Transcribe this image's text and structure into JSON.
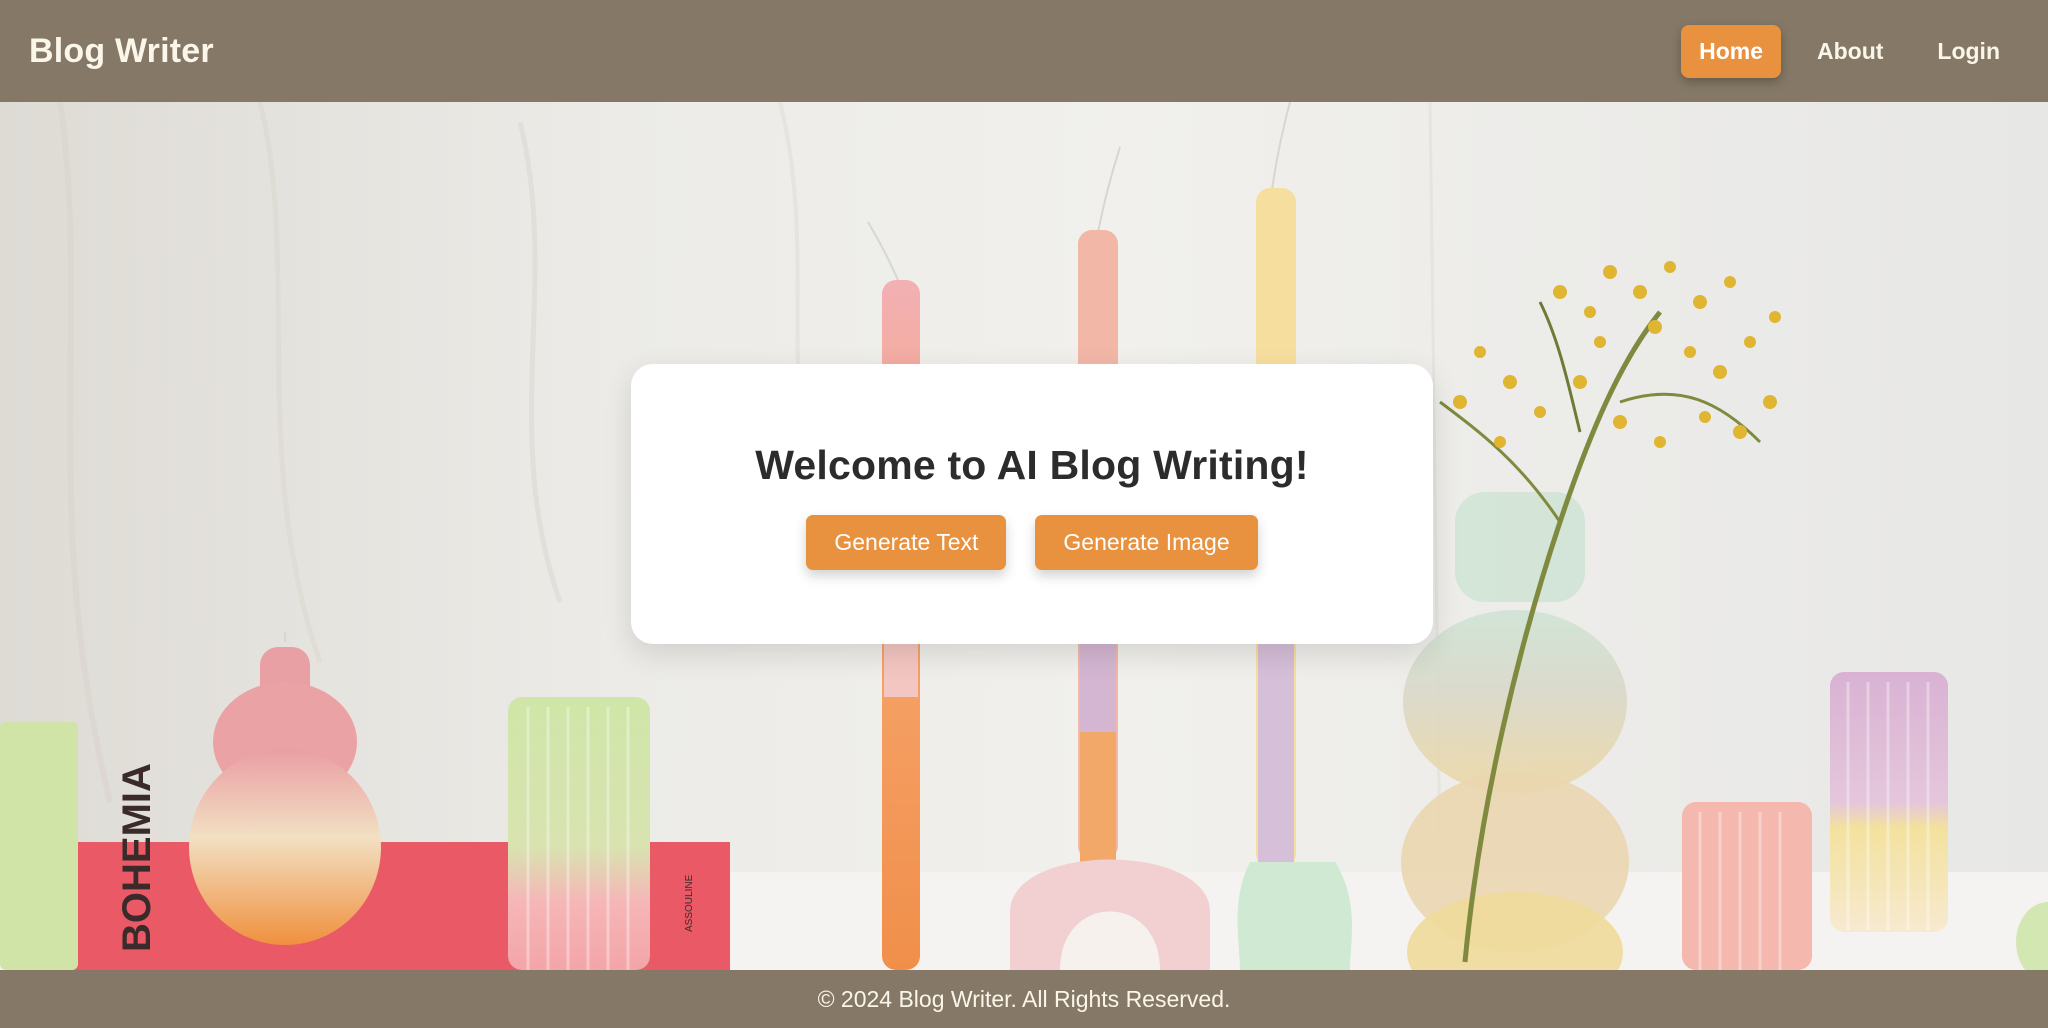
{
  "header": {
    "brand": "Blog Writer",
    "nav": [
      {
        "label": "Home",
        "active": true
      },
      {
        "label": "About",
        "active": false
      },
      {
        "label": "Login",
        "active": false
      }
    ]
  },
  "hero": {
    "heading": "Welcome to AI Blog Writing!",
    "buttons": [
      "Generate Text",
      "Generate Image"
    ],
    "book_spine_text": "BOHEMIA",
    "book_small_text": "ASSOULINE"
  },
  "footer": {
    "text": "© 2024 Blog Writer. All Rights Reserved."
  },
  "colors": {
    "bar": "#857866",
    "accent": "#e8913f",
    "card": "#ffffff"
  }
}
